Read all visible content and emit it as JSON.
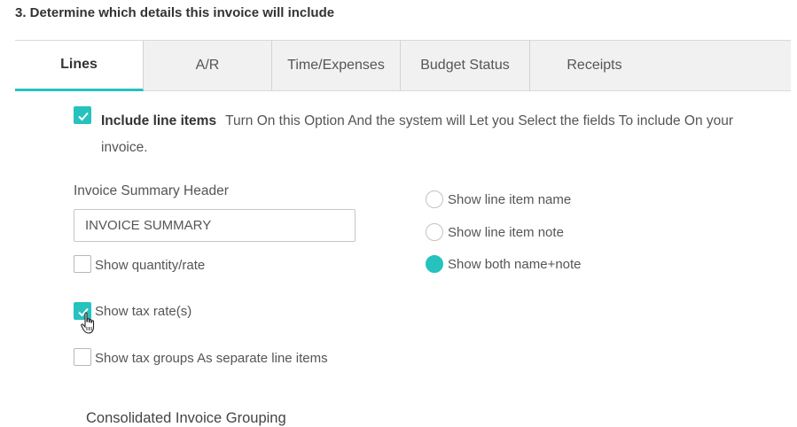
{
  "section": {
    "title": "3. Determine which details this invoice will include"
  },
  "tabs": [
    {
      "label": "Lines",
      "active": true
    },
    {
      "label": "A/R"
    },
    {
      "label": "Time/Expenses"
    },
    {
      "label": "Budget Status"
    },
    {
      "label": "Receipts"
    }
  ],
  "include_line_items": {
    "checked": true,
    "label": "Include line items",
    "description": "Turn On this Option And the system will Let you Select the fields To include On your invoice."
  },
  "summary_header": {
    "label": "Invoice Summary Header",
    "value": "INVOICE SUMMARY"
  },
  "options": {
    "show_quantity_rate": {
      "label": "Show quantity/rate",
      "checked": false
    },
    "show_tax_rate": {
      "label": "Show tax rate(s)",
      "checked": true
    },
    "show_tax_groups": {
      "label": "Show tax groups As separate line items",
      "checked": false
    }
  },
  "line_item_display": {
    "name": {
      "label": "Show line item name",
      "selected": false
    },
    "note": {
      "label": "Show line item note",
      "selected": false
    },
    "both": {
      "label": "Show both name+note",
      "selected": true
    }
  },
  "consolidated": {
    "label": "Consolidated Invoice Grouping"
  },
  "colors": {
    "accent": "#26c2bd"
  }
}
